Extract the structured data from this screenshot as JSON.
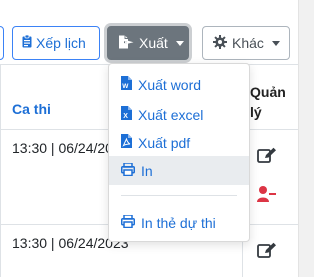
{
  "toolbar": {
    "schedule_label": "Xếp lịch",
    "export_label": "Xuất",
    "other_label": "Khác"
  },
  "table": {
    "headers": {
      "session": "Ca thi",
      "manage": "Quản lý"
    },
    "rows": [
      {
        "time": "13:30 | 06/24/2023"
      },
      {
        "time": "13:30 | 06/24/2023"
      }
    ]
  },
  "export_menu": {
    "items": [
      {
        "label": "Xuất word",
        "icon": "file-word-icon"
      },
      {
        "label": "Xuất excel",
        "icon": "file-excel-icon"
      },
      {
        "label": "Xuất pdf",
        "icon": "file-pdf-icon"
      },
      {
        "label": "In",
        "icon": "printer-icon",
        "active": true
      },
      {
        "label": "In thẻ dự thi",
        "icon": "printer-icon"
      }
    ]
  },
  "colors": {
    "primary": "#1d6fd6",
    "export_button": "#6c757d",
    "danger": "#dc3545",
    "active_item_bg": "#e9ecef"
  }
}
